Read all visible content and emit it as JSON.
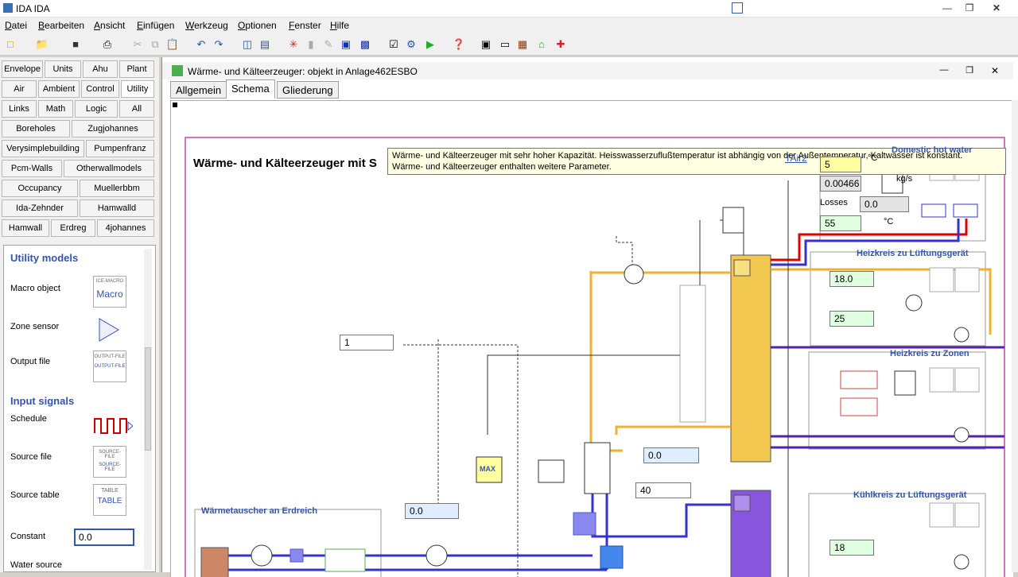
{
  "app": {
    "title": "IDA IDA"
  },
  "menu": [
    "Datei",
    "Bearbeiten",
    "Ansicht",
    "Einfügen",
    "Werkzeug",
    "Optionen",
    "Fenster",
    "Hilfe"
  ],
  "categories": [
    [
      "Envelope",
      "Units",
      "Ahu",
      "Plant"
    ],
    [
      "Air",
      "Ambient",
      "Control",
      "Utility"
    ],
    [
      "Links",
      "Math",
      "Logic",
      "All"
    ],
    [
      "Boreholes",
      "Zugjohannes"
    ],
    [
      "Verysimplebuilding",
      "Pumpenfranz"
    ],
    [
      "Pcm-Walls",
      "Otherwallmodels"
    ],
    [
      "Occupancy",
      "Muellerbbm"
    ],
    [
      "Ida-Zehnder",
      "Hamwalld"
    ],
    [
      "Hamwall",
      "Erdreg",
      "4johannes"
    ]
  ],
  "palette": {
    "utility_header": "Utility models",
    "input_header": "Input signals",
    "items": [
      {
        "label": "Macro object",
        "icon_text": "Macro",
        "icon_caption": "ICE-MACRO"
      },
      {
        "label": "Zone sensor"
      },
      {
        "label": "Output file",
        "icon_caption": "OUTPUT-FILE"
      },
      {
        "label": "Schedule"
      },
      {
        "label": "Source file",
        "icon_caption": "SOURCE-FILE"
      },
      {
        "label": "Source table",
        "icon_caption": "TABLE",
        "icon_text": "TABLE"
      },
      {
        "label": "Constant",
        "value": "0.0"
      },
      {
        "label": "Water source"
      }
    ]
  },
  "window": {
    "title": "Wärme- und Kälteerzeuger: objekt in Anlage462ESBO",
    "tabs": [
      "Allgemein",
      "Schema",
      "Gliederung"
    ],
    "active_tab": "Schema"
  },
  "schema": {
    "heading": "Wärme- und Kälteerzeuger mit S",
    "tooltip_line1": "Wärme- und Kälteerzeuger mit sehr hoher Kapazität. Heisswasserzuflußtemperatur ist abhängig von der Außentemperatur, Kaltwasser ist konstant.",
    "tooltip_line2": "Wärme- und Kälteerzeuger enthalten weitere Parameter.",
    "tair": "TAir2",
    "groups": {
      "dhw": "Domestic hot water",
      "hk_lueftung": "Heizkreis zu Lüftungsgerät",
      "hk_zonen": "Heizkreis zu Zonen",
      "kk_lueftung": "Kühlkreis zu Lüftungsgerät",
      "erdreich": "Wärmetauscher an Erdreich"
    },
    "dhw_values": {
      "v1": "5",
      "u1": "°C",
      "v2": "0.00466",
      "u2": "kg/s",
      "losses_label": "Losses",
      "losses": "0.0",
      "v3": "55",
      "u3": "°C"
    },
    "hk_values": {
      "v1": "18.0",
      "v2": "25"
    },
    "kk_values": {
      "v1": "18"
    },
    "misc": {
      "const1": "1",
      "const2": "0.0",
      "const3": "0.0",
      "const4": "40",
      "max_label": "MAX"
    }
  },
  "colors": {
    "heat": "#f0b030",
    "cold": "#3333cc",
    "red": "#dd0000",
    "group": "#3355aa"
  }
}
